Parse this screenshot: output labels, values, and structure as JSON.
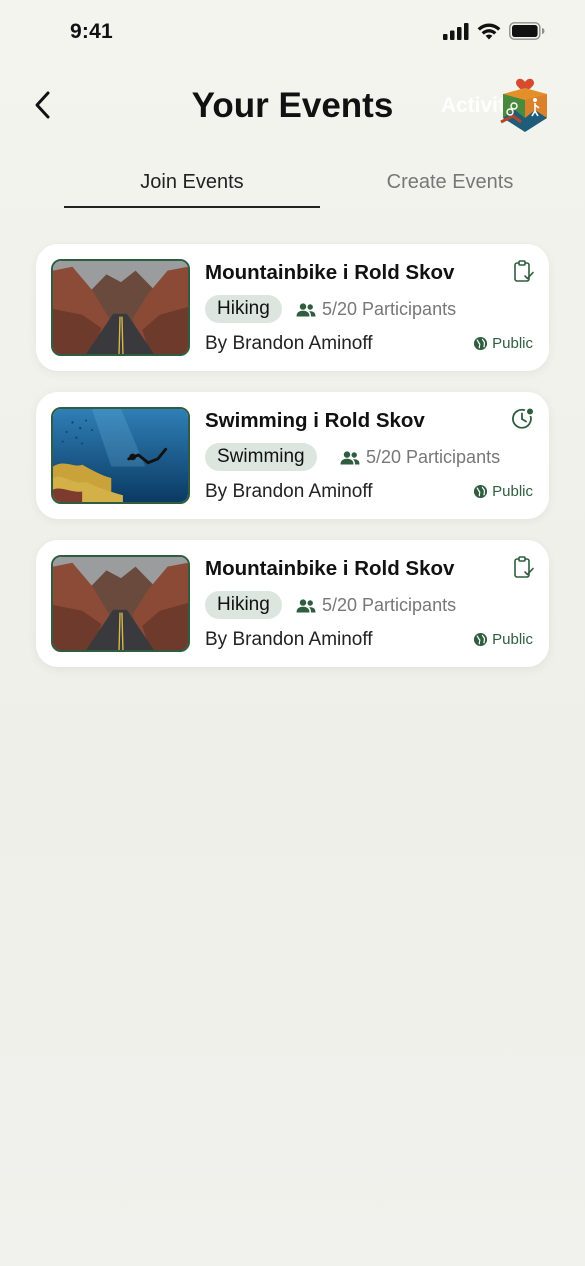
{
  "status_bar": {
    "time": "9:41"
  },
  "header": {
    "title": "Your Events",
    "logo_text": "Activit"
  },
  "tabs": [
    {
      "label": "Join Events",
      "active": true
    },
    {
      "label": "Create Events",
      "active": false
    }
  ],
  "events": [
    {
      "title": "Mountainbike i Rold Skov",
      "tag": "Hiking",
      "participants": "5/20 Participants",
      "author": "By Brandon Aminoff",
      "visibility": "Public",
      "status_icon": "clipboard-check-icon",
      "image": "canyon-road"
    },
    {
      "title": "Swimming i Rold Skov",
      "tag": "Swimming",
      "participants": "5/20 Participants",
      "author": "By Brandon Aminoff",
      "visibility": "Public",
      "status_icon": "clock-pending-icon",
      "image": "underwater-diver"
    },
    {
      "title": "Mountainbike i Rold Skov",
      "tag": "Hiking",
      "participants": "5/20 Participants",
      "author": "By Brandon Aminoff",
      "visibility": "Public",
      "status_icon": "clipboard-check-icon",
      "image": "canyon-road"
    }
  ],
  "colors": {
    "accent_green": "#2f5d3f",
    "tag_bg": "#dce6df",
    "card_bg": "#ffffff"
  }
}
